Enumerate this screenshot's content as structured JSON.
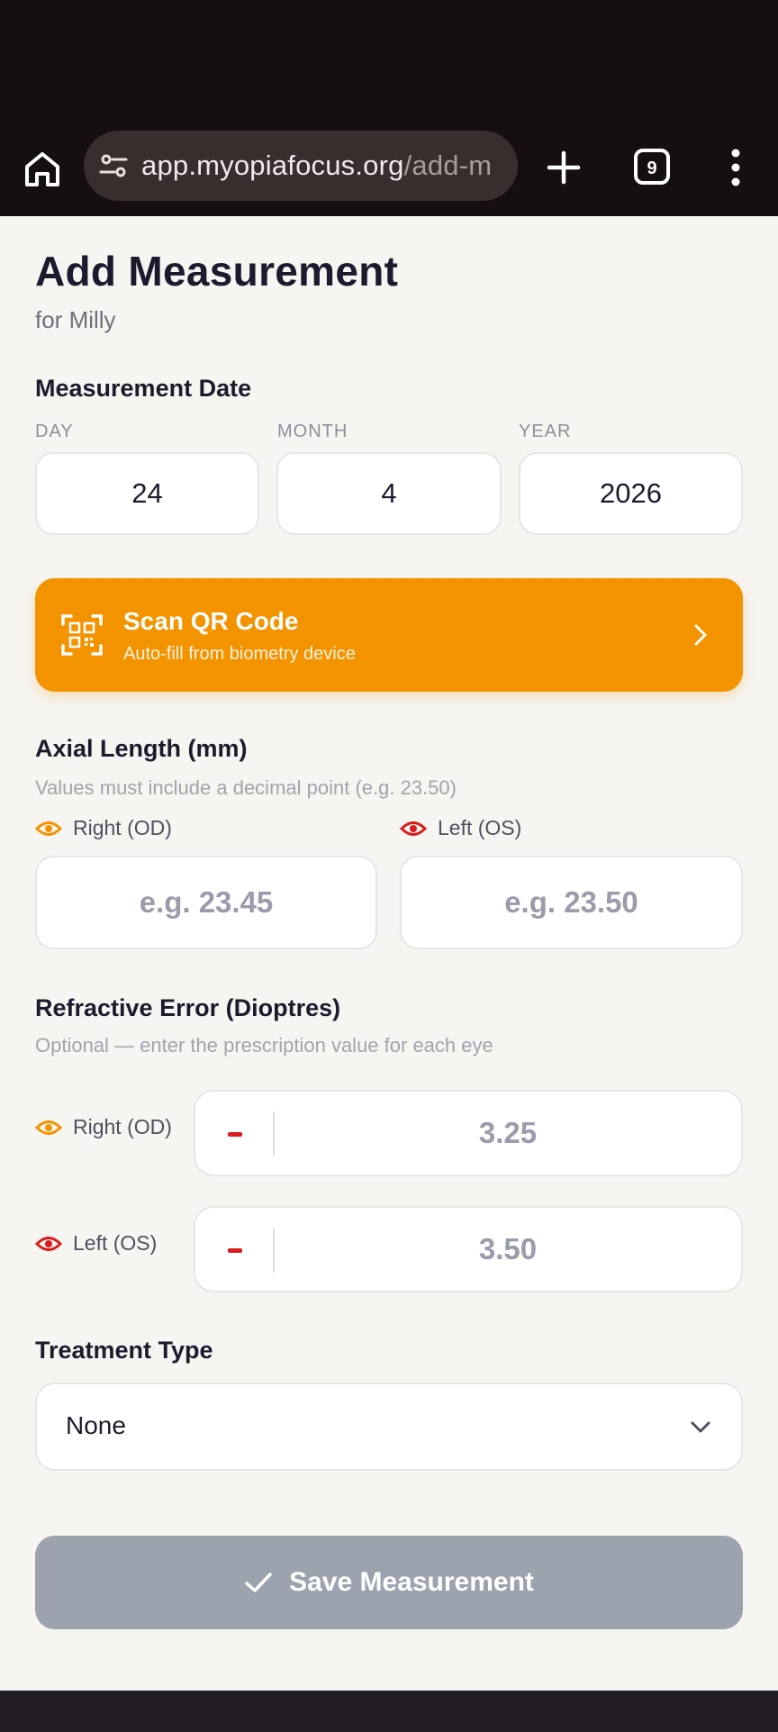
{
  "browser": {
    "url_host": "app.myopiafocus.org",
    "url_path": "/add-m",
    "tab_count": "9"
  },
  "page": {
    "title": "Add Measurement",
    "subtitle": "for Milly"
  },
  "date": {
    "section_title": "Measurement Date",
    "day_label": "DAY",
    "month_label": "MONTH",
    "year_label": "YEAR",
    "day": "24",
    "month": "4",
    "year": "2026"
  },
  "qr": {
    "title": "Scan QR Code",
    "subtitle": "Auto-fill from biometry device"
  },
  "axial": {
    "section_title": "Axial Length (mm)",
    "hint": "Values must include a decimal point (e.g. 23.50)",
    "right_label": "Right (OD)",
    "left_label": "Left (OS)",
    "right_placeholder": "e.g. 23.45",
    "left_placeholder": "e.g. 23.50"
  },
  "refraction": {
    "section_title": "Refractive Error (Dioptres)",
    "hint": "Optional — enter the prescription value for each eye",
    "right_label": "Right (OD)",
    "left_label": "Left (OS)",
    "right_placeholder": "3.25",
    "left_placeholder": "3.50"
  },
  "treatment": {
    "section_title": "Treatment Type",
    "selected": "None"
  },
  "save": {
    "label": "Save Measurement"
  },
  "colors": {
    "accent_orange": "#f39300",
    "left_eye_red": "#d91c1c",
    "disabled_gray": "#9ca3af"
  }
}
